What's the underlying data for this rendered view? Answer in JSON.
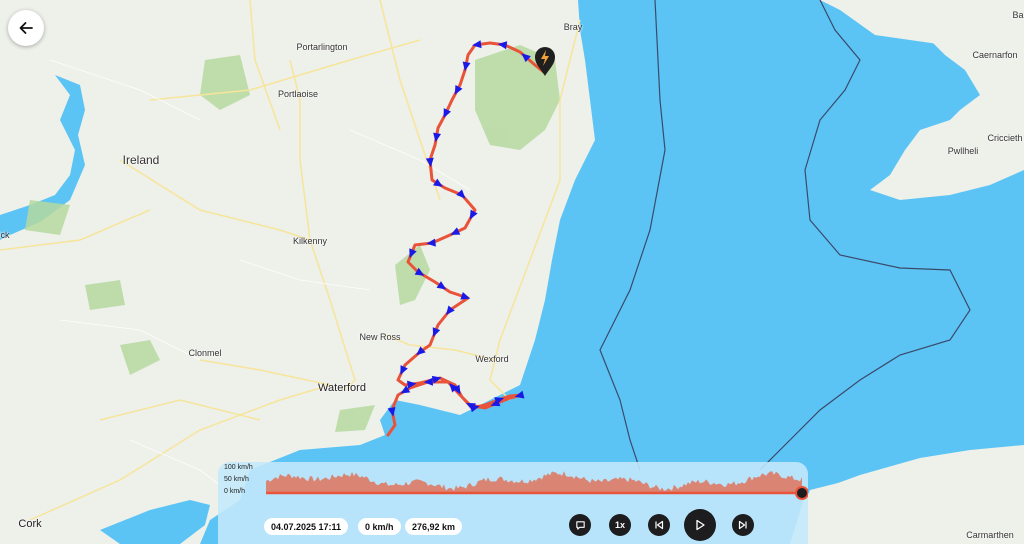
{
  "map": {
    "country_label": "Ireland",
    "places": [
      {
        "name": "Portarlington",
        "kind": "town"
      },
      {
        "name": "Portlaoise",
        "kind": "town"
      },
      {
        "name": "Kilkenny",
        "kind": "town"
      },
      {
        "name": "New Ross",
        "kind": "town"
      },
      {
        "name": "Clonmel",
        "kind": "town"
      },
      {
        "name": "Waterford",
        "kind": "big"
      },
      {
        "name": "Wexford",
        "kind": "town"
      },
      {
        "name": "Cork",
        "kind": "big"
      },
      {
        "name": "Bray",
        "kind": "town"
      },
      {
        "name": "Caernarfon",
        "kind": "town"
      },
      {
        "name": "Criccieth",
        "kind": "town"
      },
      {
        "name": "Pwllheli",
        "kind": "town"
      },
      {
        "name": "Carmarthen",
        "kind": "town"
      },
      {
        "name": "ick",
        "kind": "town"
      },
      {
        "name": "Ba",
        "kind": "town"
      }
    ],
    "route_color": "#e8533a",
    "arrow_color": "#1a1ae6",
    "water_color": "#5bc4f5",
    "land_color": "#eef0ea"
  },
  "back_button": {
    "icon": "arrow-left-icon"
  },
  "chart": {
    "labels": [
      "100 km/h",
      "50 km/h",
      "0 km/h"
    ],
    "fill_color": "#e0735a",
    "progress_color": "#e8533a"
  },
  "status": {
    "datetime": "04.07.2025 17:11",
    "speed": "0 km/h",
    "distance": "276,92 km"
  },
  "controls": {
    "comment": "comment-icon",
    "speed_label": "1x",
    "prev": "skip-back-icon",
    "play": "play-icon",
    "next": "skip-forward-icon"
  }
}
